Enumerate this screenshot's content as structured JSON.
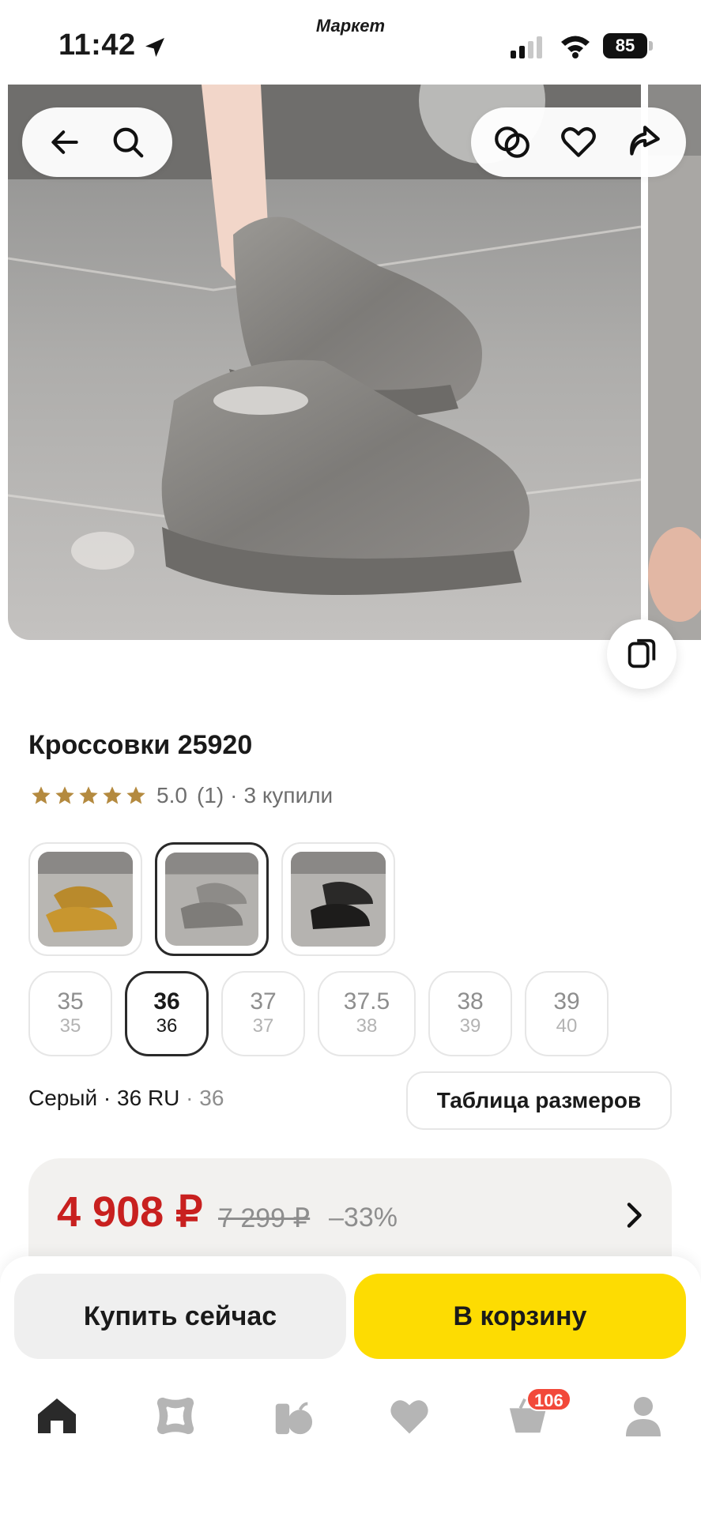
{
  "status_bar": {
    "time": "11:42",
    "app_label": "Маркет",
    "battery": "85",
    "icons": [
      "location-arrow-icon",
      "cellular-signal-icon",
      "wifi-icon",
      "battery-icon"
    ]
  },
  "gallery": {
    "top_left_icons": [
      "back-arrow-icon",
      "search-icon"
    ],
    "top_right_icons": [
      "compare-icon",
      "heart-icon",
      "share-icon"
    ],
    "fab_icon": "compare-cards-icon"
  },
  "product": {
    "title": "Кроссовки 25920",
    "rating_value": "5.0",
    "rating_count": "(1)",
    "separator": "·",
    "bought": "3 купили",
    "rating_stars": 5,
    "star_color": "#b48a3f"
  },
  "variants": [
    {
      "name": "gold",
      "selected": false
    },
    {
      "name": "silver",
      "selected": true
    },
    {
      "name": "black",
      "selected": false
    }
  ],
  "sizes": [
    {
      "main": "35",
      "sub": "35",
      "selected": false
    },
    {
      "main": "36",
      "sub": "36",
      "selected": true
    },
    {
      "main": "37",
      "sub": "37",
      "selected": false
    },
    {
      "main": "37.5",
      "sub": "38",
      "selected": false
    },
    {
      "main": "38",
      "sub": "39",
      "selected": false
    },
    {
      "main": "39",
      "sub": "40",
      "selected": false
    }
  ],
  "selection": {
    "color": "Серый",
    "dot1": " · ",
    "size_ru": "36 RU",
    "dot2": " · ",
    "size_alt": "36",
    "size_table_label": "Таблица размеров"
  },
  "price": {
    "current": "4 908 ₽",
    "old": "7 299 ₽",
    "discount": "–33%",
    "current_color": "#c8201f"
  },
  "actions": {
    "buy_now": "Купить сейчас",
    "add_to_cart": "В корзину",
    "cart_button_color": "#fddc02"
  },
  "tabbar": {
    "icons": [
      "home-icon",
      "catalog-icon",
      "grocery-icon",
      "favorites-icon",
      "cart-icon",
      "profile-icon"
    ],
    "cart_badge": "106",
    "badge_color": "#f2493a"
  }
}
